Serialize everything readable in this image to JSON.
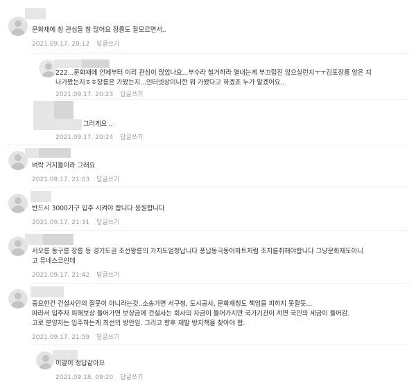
{
  "comments": [
    {
      "id": "c1",
      "lines": [
        "문화재에 참 관심들 참 많어요 장릉도 잘모르면서.."
      ],
      "date": "2021.09.17. 20:12",
      "reply_label": "답글쓰기"
    },
    {
      "id": "c2",
      "lines": [
        "222...문화재에 언제부터 이리 관심이 많았나요...부수라 철거하라 열내는게 부끄럽진 않으실런지ㅜㅜ김포장릉 앞은 지",
        "나가봤는지ㅎㅎ장릉은 가봤는지...인터넷상이니깐 뭐 가봤다고 하겠죠 누가 알겠어요.."
      ],
      "date": "2021.09.17. 20:23",
      "reply_label": "답글쓰기"
    },
    {
      "id": "c3",
      "lines": [
        "그러게요 .."
      ],
      "date": "2021.09.17. 20:24",
      "reply_label": "답글쓰기"
    },
    {
      "id": "c4",
      "lines": [
        "벼락 거지들이라 그래요"
      ],
      "date": "2021.09.17. 21:03",
      "reply_label": "답글쓰기"
    },
    {
      "id": "c5",
      "lines": [
        "반드시 3000가구 입주 시켜야 합니다 응원합니다"
      ],
      "date": "2021.09.17. 21:31",
      "reply_label": "답글쓰기"
    },
    {
      "id": "c6",
      "lines": [
        "서오릉 동구릉 장릉 등 경기도권 조선왕릉의 가치도엄청납니다 풍납동극동아파트처럼 조치를취해야합니다 그냥문화재도아니",
        "고 유네스코인데"
      ],
      "date": "2021.09.17. 21:42",
      "reply_label": "답글쓰기"
    },
    {
      "id": "c7",
      "lines": [
        "중요한건 건설사만의 잘못이 아니라는것..소송가면 서구청, 도시공사, 문화재청도 책임을 피하지 못할듯...",
        "따라서 입주자 피해보상 들어가면 보상금에 건설사는 회사의 자금이 들어가지만 국가기관이 끼면 국민의 세금이 들어감.",
        "고로 분양자는 입주하는게 최선의 방안임. 그리고 향후 재발 방지책을 찾아야 함."
      ],
      "date": "2021.09.17. 21:59",
      "reply_label": "답글쓰기"
    },
    {
      "id": "c8",
      "lines": [
        "이말이 정답같아요"
      ],
      "date": "2021.09.18. 09:20",
      "reply_label": "답글쓰기"
    }
  ],
  "top_meta": {
    "reply_label": "답글쓰기"
  }
}
